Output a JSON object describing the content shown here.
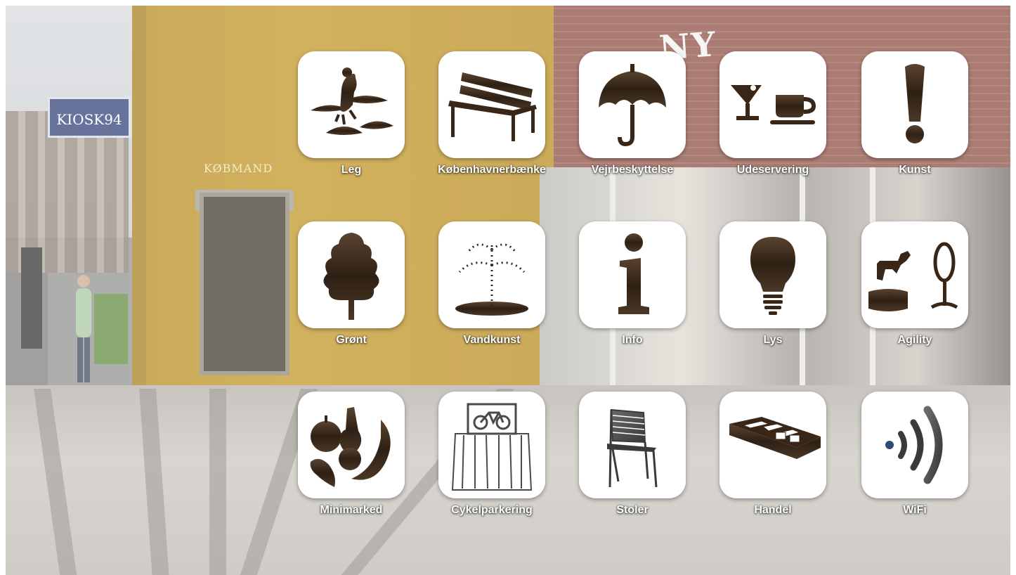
{
  "scene": {
    "sign_kiosk": "KIOSK94",
    "sign_shop": "KØBMAND",
    "sign_ny": "NY"
  },
  "icons": [
    {
      "label": "Leg",
      "icon": "playground-icon"
    },
    {
      "label": "Københavnerbænke",
      "icon": "bench-icon"
    },
    {
      "label": "Vejrbeskyttelse",
      "icon": "umbrella-icon"
    },
    {
      "label": "Udeservering",
      "icon": "cocktail-coffee-icon"
    },
    {
      "label": "Kunst",
      "icon": "exclamation-icon"
    },
    {
      "label": "Grønt",
      "icon": "tree-icon"
    },
    {
      "label": "Vandkunst",
      "icon": "fountain-icon"
    },
    {
      "label": "Info",
      "icon": "info-icon"
    },
    {
      "label": "Lys",
      "icon": "lightbulb-icon"
    },
    {
      "label": "Agility",
      "icon": "dog-agility-icon"
    },
    {
      "label": "Minimarked",
      "icon": "fruit-vegetables-icon"
    },
    {
      "label": "Cykelparkering",
      "icon": "bike-parking-icon"
    },
    {
      "label": "Stoler",
      "icon": "chair-icon"
    },
    {
      "label": "Handel",
      "icon": "market-stall-icon"
    },
    {
      "label": "WiFi",
      "icon": "wifi-icon"
    }
  ],
  "colors": {
    "icon_fill": "#3a2616",
    "tile_bg": "#ffffff",
    "label_text": "#ffffff"
  }
}
